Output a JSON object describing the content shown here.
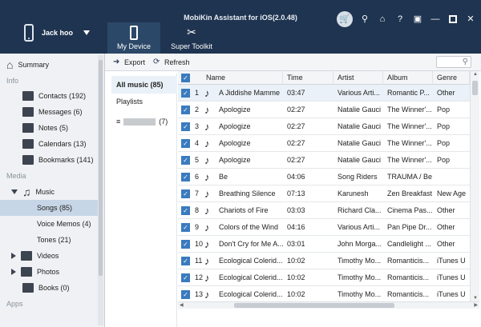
{
  "app": {
    "title": "MobiKin Assistant for iOS(2.0.48)"
  },
  "device": {
    "name": "Jack hoo"
  },
  "tabs": [
    {
      "label": "My Device",
      "active": true
    },
    {
      "label": "Super Toolkit",
      "active": false
    }
  ],
  "window_controls": [
    "cart-icon",
    "key-icon",
    "home-icon",
    "help-icon",
    "feedback-icon",
    "minimize-icon",
    "maximize-icon",
    "close-icon"
  ],
  "window_glyphs": {
    "key": "⚲",
    "home": "⌂",
    "help": "?",
    "feedback": "▣",
    "minimize": "—",
    "close": "✕"
  },
  "sidebar": {
    "summary": "Summary",
    "sections": {
      "info": "Info",
      "media": "Media",
      "apps": "Apps"
    },
    "items": {
      "contacts": "Contacts  (192)",
      "messages": "Messages  (6)",
      "notes": "Notes  (5)",
      "calendars": "Calendars  (13)",
      "bookmarks": "Bookmarks  (141)",
      "music": "Music",
      "songs": "Songs  (85)",
      "voice_memos": "Voice Memos  (4)",
      "tones": "Tones  (21)",
      "videos": "Videos",
      "photos": "Photos",
      "books": "Books  (0)"
    }
  },
  "toolbar": {
    "export": "Export",
    "refresh": "Refresh"
  },
  "categories": {
    "all_music": "All music (85)",
    "playlists": "Playlists",
    "hidden_count": "(7)"
  },
  "columns": [
    "Name",
    "Time",
    "Artist",
    "Album",
    "Genre"
  ],
  "rows": [
    {
      "n": "1",
      "name": "A Jiddishe Mamme",
      "time": "03:47",
      "artist": "Various Arti...",
      "album": "Romantic P...",
      "genre": "Other"
    },
    {
      "n": "2",
      "name": "Apologize",
      "time": "02:27",
      "artist": "Natalie Gauci",
      "album": "The Winner'...",
      "genre": "Pop"
    },
    {
      "n": "3",
      "name": "Apologize",
      "time": "02:27",
      "artist": "Natalie Gauci",
      "album": "The Winner'...",
      "genre": "Pop"
    },
    {
      "n": "4",
      "name": "Apologize",
      "time": "02:27",
      "artist": "Natalie Gauci",
      "album": "The Winner'...",
      "genre": "Pop"
    },
    {
      "n": "5",
      "name": "Apologize",
      "time": "02:27",
      "artist": "Natalie Gauci",
      "album": "The Winner'...",
      "genre": "Pop"
    },
    {
      "n": "6",
      "name": "Be",
      "time": "04:06",
      "artist": "Song Riders",
      "album": "TRAUMA / Be",
      "genre": ""
    },
    {
      "n": "7",
      "name": "Breathing Silence",
      "time": "07:13",
      "artist": "Karunesh",
      "album": "Zen Breakfast",
      "genre": "New Age"
    },
    {
      "n": "8",
      "name": "Chariots of Fire",
      "time": "03:03",
      "artist": "Richard Cla...",
      "album": "Cinema Pas...",
      "genre": "Other"
    },
    {
      "n": "9",
      "name": "Colors of the Wind",
      "time": "04:16",
      "artist": "Various Arti...",
      "album": "Pan Pipe Dr...",
      "genre": "Other"
    },
    {
      "n": "10",
      "name": "Don't Cry for Me A...",
      "time": "03:01",
      "artist": "John Morga...",
      "album": "Candlelight ...",
      "genre": "Other"
    },
    {
      "n": "11",
      "name": "Ecological Colerid...",
      "time": "10:02",
      "artist": "Timothy Mo...",
      "album": "Romanticis...",
      "genre": "iTunes U"
    },
    {
      "n": "12",
      "name": "Ecological Colerid...",
      "time": "10:02",
      "artist": "Timothy Mo...",
      "album": "Romanticis...",
      "genre": "iTunes U"
    },
    {
      "n": "13",
      "name": "Ecological Colerid...",
      "time": "10:02",
      "artist": "Timothy Mo...",
      "album": "Romanticis...",
      "genre": "iTunes U"
    }
  ],
  "colors": {
    "header": "#1f3450",
    "accent": "#3a7bbf",
    "selected": "#c7d6e6"
  }
}
